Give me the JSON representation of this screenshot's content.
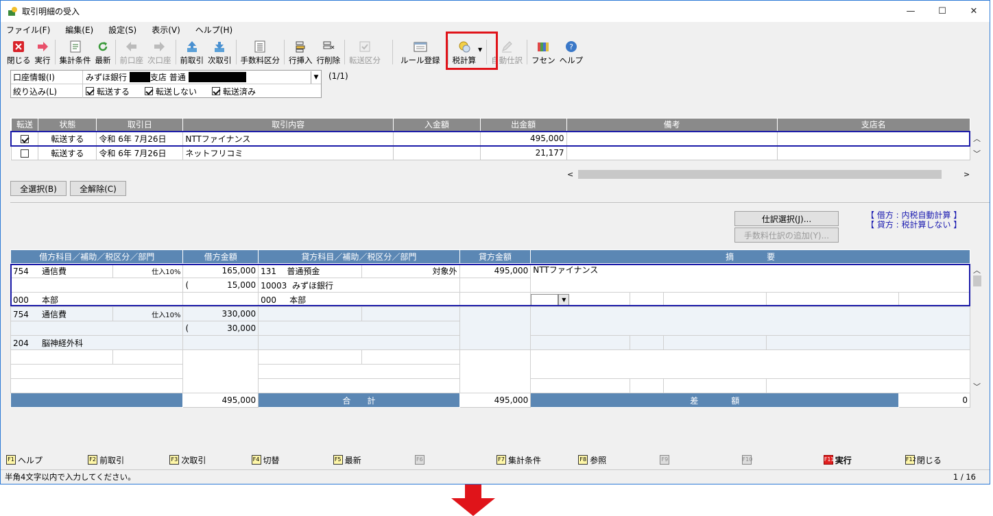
{
  "window": {
    "title": "取引明細の受入",
    "min": "—",
    "max": "☐",
    "close": "✕"
  },
  "menu": [
    "ファイル(F)",
    "編集(E)",
    "設定(S)",
    "表示(V)",
    "ヘルプ(H)"
  ],
  "toolbar": {
    "close": "閉じる",
    "run": "実行",
    "agg": "集計条件",
    "latest": "最新",
    "prev_acct": "前口座",
    "next_acct": "次口座",
    "prev_tx": "前取引",
    "next_tx": "次取引",
    "fee_cat": "手数料区分",
    "row_ins": "行挿入",
    "row_del": "行削除",
    "transfer_cat": "転送区分",
    "rule_reg": "ルール登録",
    "tax_calc": "税計算",
    "auto_journal": "自動仕訳",
    "fusen": "フセン",
    "help": "ヘルプ"
  },
  "account": {
    "label": "口座情報(I)",
    "bank": "みずほ銀行",
    "branch": "支店",
    "type": "普通",
    "pager": "(1/1)"
  },
  "filter": {
    "label": "絞り込み(L)",
    "opt1": "転送する",
    "opt2": "転送しない",
    "opt3": "転送済み"
  },
  "tx_table": {
    "headers": [
      "転送",
      "状態",
      "取引日",
      "取引内容",
      "入金額",
      "出金額",
      "備考",
      "支店名"
    ],
    "rows": [
      {
        "checked": true,
        "status": "転送する",
        "date": "令和 6年 7月26日",
        "desc": "NTTファイナンス",
        "in": "",
        "out": "495,000",
        "memo": "",
        "branch": ""
      },
      {
        "checked": false,
        "status": "転送する",
        "date": "令和 6年 7月26日",
        "desc": "ネットフリコミ",
        "in": "",
        "out": "21,177",
        "memo": "",
        "branch": ""
      }
    ]
  },
  "buttons": {
    "select_all": "全選択(B)",
    "clear_all": "全解除(C)",
    "journal_select": "仕訳選択(J)...",
    "add_fee_journal": "手数料仕訳の追加(Y)..."
  },
  "info": {
    "debit": "【 借方 : 内税自動計算 】",
    "credit": "【 貸方 : 税計算しない 】"
  },
  "journal": {
    "headers": [
      "借方科目／補助／税区分／部門",
      "借方金額",
      "貸方科目／補助／税区分／部門",
      "貸方金額",
      "摘　　　　要"
    ],
    "e1": {
      "dcode": "754",
      "dname": "通信費",
      "dtax": "仕入10%",
      "damt": "165,000",
      "dtaxamt": "15,000",
      "paren": "(",
      "dsub_code": "000",
      "dsub": "本部",
      "ccode": "131",
      "cname": "普通預金",
      "ctax": "対象外",
      "camt": "495,000",
      "caux_code": "10003",
      "caux": "みずほ銀行",
      "csub_code": "000",
      "csub": "本部",
      "memo": "NTTファイナンス"
    },
    "e2": {
      "dcode": "754",
      "dname": "通信費",
      "dtax": "仕入10%",
      "damt": "330,000",
      "dtaxamt": "30,000",
      "paren": "(",
      "dsub_code": "204",
      "dsub": "脳神経外科"
    },
    "total_label": "合　　計",
    "diff_label": "差　　　　額",
    "dtotal": "495,000",
    "ctotal": "495,000",
    "diff": "0"
  },
  "fkeys": [
    {
      "k": "F1",
      "l": "ヘルプ"
    },
    {
      "k": "F2",
      "l": "前取引"
    },
    {
      "k": "F3",
      "l": "次取引"
    },
    {
      "k": "F4",
      "l": "切替"
    },
    {
      "k": "F5",
      "l": "最新"
    },
    {
      "k": "F6",
      "l": ""
    },
    {
      "k": "F7",
      "l": "集計条件"
    },
    {
      "k": "F8",
      "l": "参照"
    },
    {
      "k": "F9",
      "l": ""
    },
    {
      "k": "F10",
      "l": ""
    },
    {
      "k": "F11",
      "l": "実行"
    },
    {
      "k": "F12",
      "l": "閉じる"
    }
  ],
  "status": {
    "msg": "半角4文字以内で入力してください。",
    "page": "1 / 16"
  },
  "colors": {
    "accent_red": "#e0141a",
    "journal_header": "#5b87b4",
    "tx_header": "#8a8a8a"
  }
}
